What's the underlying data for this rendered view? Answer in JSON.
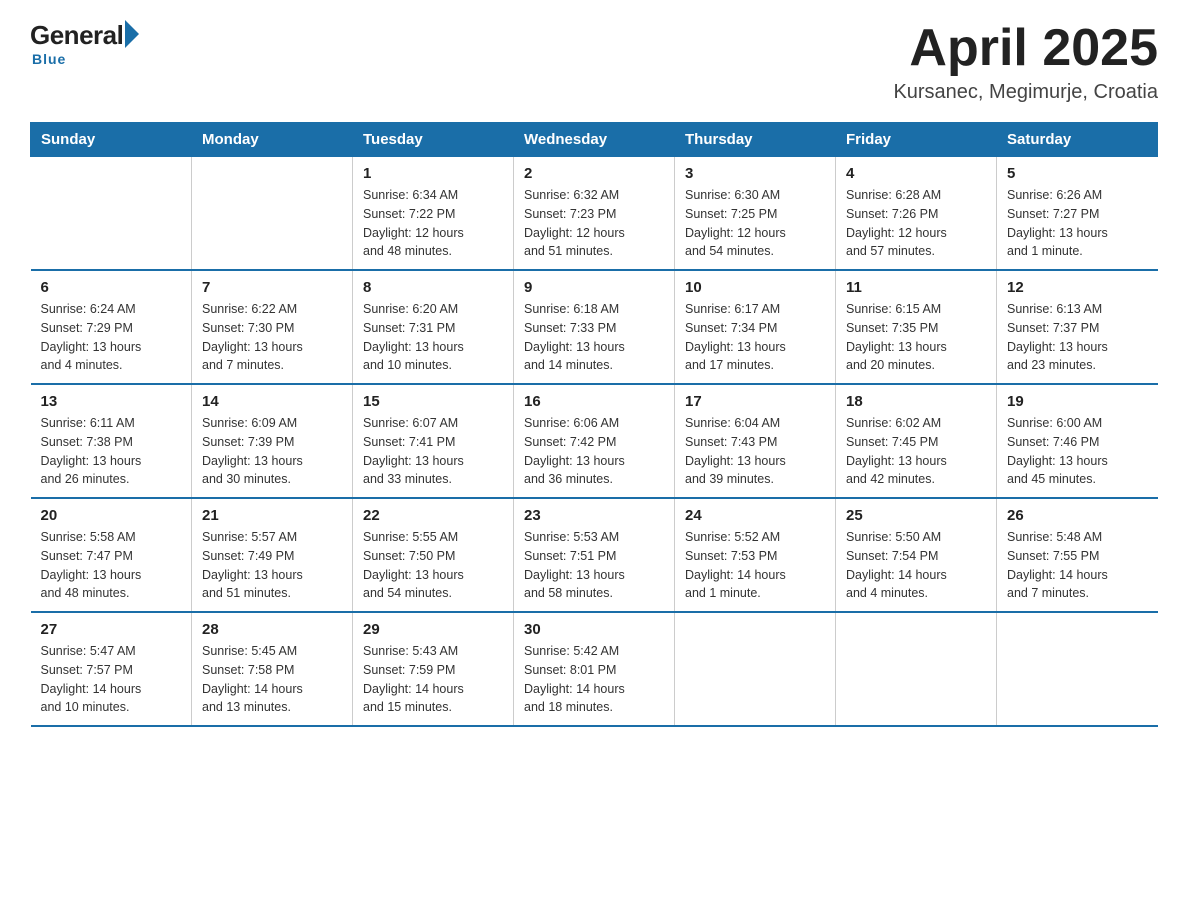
{
  "header": {
    "logo": {
      "general": "General",
      "blue": "Blue",
      "tagline": "Blue"
    },
    "title": "April 2025",
    "location": "Kursanec, Megimurje, Croatia"
  },
  "calendar": {
    "days_of_week": [
      "Sunday",
      "Monday",
      "Tuesday",
      "Wednesday",
      "Thursday",
      "Friday",
      "Saturday"
    ],
    "weeks": [
      [
        {
          "day": "",
          "info": ""
        },
        {
          "day": "",
          "info": ""
        },
        {
          "day": "1",
          "info": "Sunrise: 6:34 AM\nSunset: 7:22 PM\nDaylight: 12 hours\nand 48 minutes."
        },
        {
          "day": "2",
          "info": "Sunrise: 6:32 AM\nSunset: 7:23 PM\nDaylight: 12 hours\nand 51 minutes."
        },
        {
          "day": "3",
          "info": "Sunrise: 6:30 AM\nSunset: 7:25 PM\nDaylight: 12 hours\nand 54 minutes."
        },
        {
          "day": "4",
          "info": "Sunrise: 6:28 AM\nSunset: 7:26 PM\nDaylight: 12 hours\nand 57 minutes."
        },
        {
          "day": "5",
          "info": "Sunrise: 6:26 AM\nSunset: 7:27 PM\nDaylight: 13 hours\nand 1 minute."
        }
      ],
      [
        {
          "day": "6",
          "info": "Sunrise: 6:24 AM\nSunset: 7:29 PM\nDaylight: 13 hours\nand 4 minutes."
        },
        {
          "day": "7",
          "info": "Sunrise: 6:22 AM\nSunset: 7:30 PM\nDaylight: 13 hours\nand 7 minutes."
        },
        {
          "day": "8",
          "info": "Sunrise: 6:20 AM\nSunset: 7:31 PM\nDaylight: 13 hours\nand 10 minutes."
        },
        {
          "day": "9",
          "info": "Sunrise: 6:18 AM\nSunset: 7:33 PM\nDaylight: 13 hours\nand 14 minutes."
        },
        {
          "day": "10",
          "info": "Sunrise: 6:17 AM\nSunset: 7:34 PM\nDaylight: 13 hours\nand 17 minutes."
        },
        {
          "day": "11",
          "info": "Sunrise: 6:15 AM\nSunset: 7:35 PM\nDaylight: 13 hours\nand 20 minutes."
        },
        {
          "day": "12",
          "info": "Sunrise: 6:13 AM\nSunset: 7:37 PM\nDaylight: 13 hours\nand 23 minutes."
        }
      ],
      [
        {
          "day": "13",
          "info": "Sunrise: 6:11 AM\nSunset: 7:38 PM\nDaylight: 13 hours\nand 26 minutes."
        },
        {
          "day": "14",
          "info": "Sunrise: 6:09 AM\nSunset: 7:39 PM\nDaylight: 13 hours\nand 30 minutes."
        },
        {
          "day": "15",
          "info": "Sunrise: 6:07 AM\nSunset: 7:41 PM\nDaylight: 13 hours\nand 33 minutes."
        },
        {
          "day": "16",
          "info": "Sunrise: 6:06 AM\nSunset: 7:42 PM\nDaylight: 13 hours\nand 36 minutes."
        },
        {
          "day": "17",
          "info": "Sunrise: 6:04 AM\nSunset: 7:43 PM\nDaylight: 13 hours\nand 39 minutes."
        },
        {
          "day": "18",
          "info": "Sunrise: 6:02 AM\nSunset: 7:45 PM\nDaylight: 13 hours\nand 42 minutes."
        },
        {
          "day": "19",
          "info": "Sunrise: 6:00 AM\nSunset: 7:46 PM\nDaylight: 13 hours\nand 45 minutes."
        }
      ],
      [
        {
          "day": "20",
          "info": "Sunrise: 5:58 AM\nSunset: 7:47 PM\nDaylight: 13 hours\nand 48 minutes."
        },
        {
          "day": "21",
          "info": "Sunrise: 5:57 AM\nSunset: 7:49 PM\nDaylight: 13 hours\nand 51 minutes."
        },
        {
          "day": "22",
          "info": "Sunrise: 5:55 AM\nSunset: 7:50 PM\nDaylight: 13 hours\nand 54 minutes."
        },
        {
          "day": "23",
          "info": "Sunrise: 5:53 AM\nSunset: 7:51 PM\nDaylight: 13 hours\nand 58 minutes."
        },
        {
          "day": "24",
          "info": "Sunrise: 5:52 AM\nSunset: 7:53 PM\nDaylight: 14 hours\nand 1 minute."
        },
        {
          "day": "25",
          "info": "Sunrise: 5:50 AM\nSunset: 7:54 PM\nDaylight: 14 hours\nand 4 minutes."
        },
        {
          "day": "26",
          "info": "Sunrise: 5:48 AM\nSunset: 7:55 PM\nDaylight: 14 hours\nand 7 minutes."
        }
      ],
      [
        {
          "day": "27",
          "info": "Sunrise: 5:47 AM\nSunset: 7:57 PM\nDaylight: 14 hours\nand 10 minutes."
        },
        {
          "day": "28",
          "info": "Sunrise: 5:45 AM\nSunset: 7:58 PM\nDaylight: 14 hours\nand 13 minutes."
        },
        {
          "day": "29",
          "info": "Sunrise: 5:43 AM\nSunset: 7:59 PM\nDaylight: 14 hours\nand 15 minutes."
        },
        {
          "day": "30",
          "info": "Sunrise: 5:42 AM\nSunset: 8:01 PM\nDaylight: 14 hours\nand 18 minutes."
        },
        {
          "day": "",
          "info": ""
        },
        {
          "day": "",
          "info": ""
        },
        {
          "day": "",
          "info": ""
        }
      ]
    ]
  }
}
